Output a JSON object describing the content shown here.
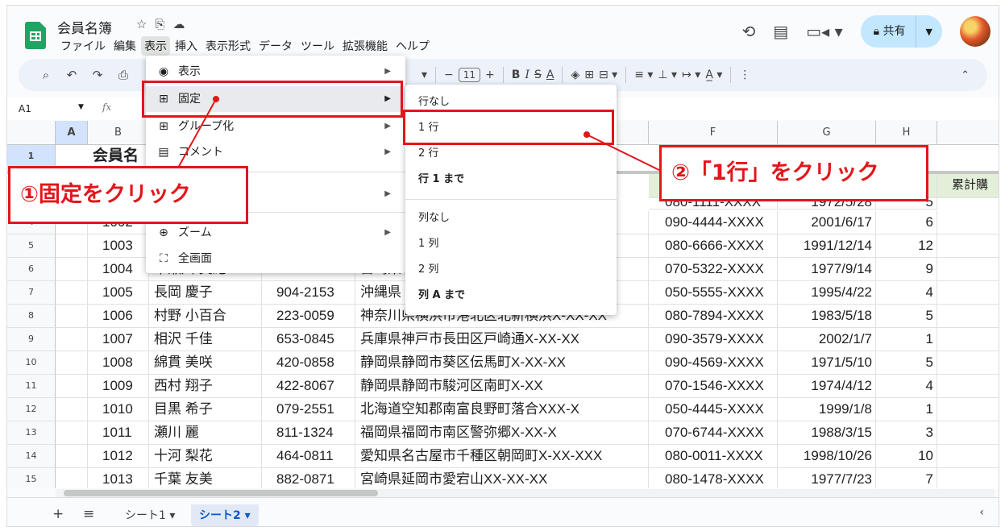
{
  "title": {
    "doc_name": "会員名簿",
    "menus": [
      "ファイル",
      "編集",
      "表示",
      "挿入",
      "表示形式",
      "データ",
      "ツール",
      "拡張機能",
      "ヘルプ"
    ],
    "share_label": "共有"
  },
  "toolbar": {
    "font_size": "11",
    "bold": "B",
    "italic": "I",
    "text_color": "A"
  },
  "formula_bar": {
    "cell_ref": "A1",
    "fx": "fx"
  },
  "columns": [
    "A",
    "B",
    "F",
    "G",
    "H"
  ],
  "row_header_nums": [
    "1",
    "4",
    "5",
    "6",
    "7",
    "8",
    "9",
    "10",
    "11",
    "12",
    "13",
    "14",
    "15"
  ],
  "sheet": {
    "title_cell": "会員名",
    "col_i_header": "累計購",
    "partial_rows": [
      {
        "phone": "080-1111-XXXX",
        "birth": "1972/5/28",
        "count": "5"
      }
    ],
    "rows": [
      {
        "num": "4",
        "id": "1002",
        "name": "",
        "zip": "",
        "addr": "",
        "phone": "090-4444-XXXX",
        "birth": "2001/6/17",
        "count": "6"
      },
      {
        "num": "5",
        "id": "1003",
        "name": "",
        "zip": "",
        "addr": "",
        "phone": "080-6666-XXXX",
        "birth": "1991/12/14",
        "count": "12"
      },
      {
        "num": "6",
        "id": "1004",
        "name": "早瀬川 美紀",
        "zip": "887-0004",
        "addr": "宮崎県",
        "phone": "070-5322-XXXX",
        "birth": "1977/9/14",
        "count": "9"
      },
      {
        "num": "7",
        "id": "1005",
        "name": "長岡 慶子",
        "zip": "904-2153",
        "addr": "沖縄県",
        "phone": "050-5555-XXXX",
        "birth": "1995/4/22",
        "count": "4"
      },
      {
        "num": "8",
        "id": "1006",
        "name": "村野 小百合",
        "zip": "223-0059",
        "addr": "神奈川県横浜市港北区北新横浜X-XX-XX",
        "phone": "080-7894-XXXX",
        "birth": "1983/5/18",
        "count": "5"
      },
      {
        "num": "9",
        "id": "1007",
        "name": "相沢 千佳",
        "zip": "653-0845",
        "addr": "兵庫県神戸市長田区戸崎通X-XX-XX",
        "phone": "090-3579-XXXX",
        "birth": "2002/1/7",
        "count": "1"
      },
      {
        "num": "10",
        "id": "1008",
        "name": "綿貫 美咲",
        "zip": "420-0858",
        "addr": "静岡県静岡市葵区伝馬町X-XX-XX",
        "phone": "090-4569-XXXX",
        "birth": "1971/5/10",
        "count": "5"
      },
      {
        "num": "11",
        "id": "1009",
        "name": "西村 翔子",
        "zip": "422-8067",
        "addr": "静岡県静岡市駿河区南町X-XX",
        "phone": "070-1546-XXXX",
        "birth": "1974/4/12",
        "count": "4"
      },
      {
        "num": "12",
        "id": "1010",
        "name": "目黒 希子",
        "zip": "079-2551",
        "addr": "北海道空知郡南富良野町落合XXX-X",
        "phone": "050-4445-XXXX",
        "birth": "1999/1/8",
        "count": "1"
      },
      {
        "num": "13",
        "id": "1011",
        "name": "瀬川 麗",
        "zip": "811-1324",
        "addr": "福岡県福岡市南区警弥郷X-XX-X",
        "phone": "070-6744-XXXX",
        "birth": "1988/3/15",
        "count": "3"
      },
      {
        "num": "14",
        "id": "1012",
        "name": "十河 梨花",
        "zip": "464-0811",
        "addr": "愛知県名古屋市千種区朝岡町X-XX-XXX",
        "phone": "080-0011-XXXX",
        "birth": "1998/10/26",
        "count": "10"
      },
      {
        "num": "15",
        "id": "1013",
        "name": "千葉 友美",
        "zip": "882-0871",
        "addr": "宮崎県延岡市愛宕山XX-XX-XX",
        "phone": "080-1478-XXXX",
        "birth": "1977/7/23",
        "count": "7"
      }
    ]
  },
  "view_menu": {
    "items": [
      {
        "label": "表示",
        "icon": "eye-icon"
      },
      {
        "label": "固定",
        "icon": "freeze-icon"
      },
      {
        "label": "グループ化",
        "icon": "group-icon"
      },
      {
        "label": "コメント",
        "icon": "comment-icon"
      },
      {
        "label": "ズーム",
        "icon": "zoom-icon"
      },
      {
        "label": "全画面",
        "icon": "fullscreen-icon"
      }
    ]
  },
  "freeze_submenu": {
    "items": [
      "行なし",
      "1 行",
      "2 行",
      "行 1 まで",
      "列なし",
      "1 列",
      "2 列",
      "列 A まで"
    ]
  },
  "annotations": {
    "step1": "①固定をクリック",
    "step2": "②「1行」をクリック"
  },
  "tabs": [
    "シート1",
    "シート2"
  ],
  "colors": {
    "accent_red": "#e2161b",
    "share_bg": "#c2e7ff",
    "sheets_green": "#1fa463"
  }
}
